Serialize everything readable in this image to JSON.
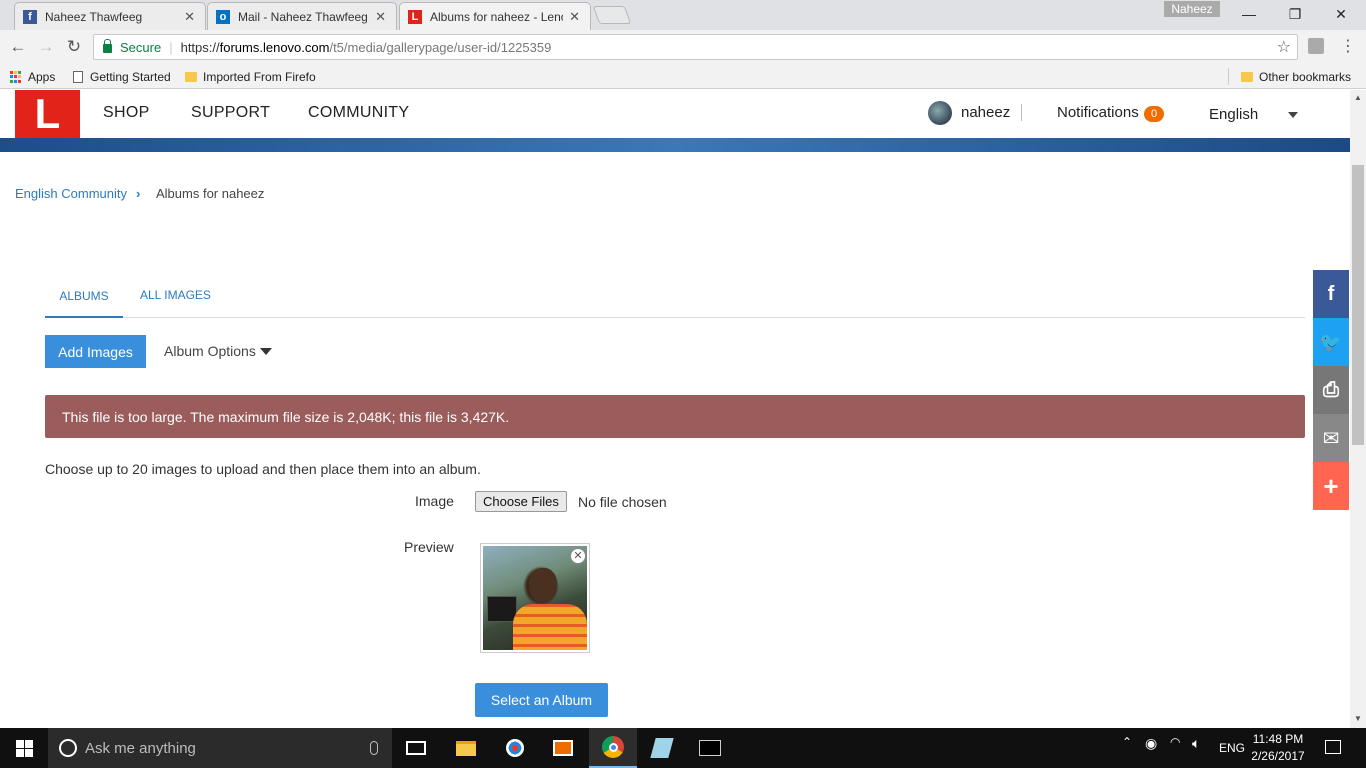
{
  "browser": {
    "tabs": [
      {
        "title": "Naheez Thawfeeg",
        "icon": "facebook-icon",
        "color": "#3b5998"
      },
      {
        "title": "Mail - Naheez Thawfeeg",
        "icon": "outlook-icon",
        "color": "#0072c6"
      },
      {
        "title": "Albums for naheez - Leno",
        "icon": "lenovo-icon",
        "color": "#e2231a"
      }
    ],
    "profile_name": "Naheez",
    "secure_label": "Secure",
    "url_scheme": "https://",
    "url_domain": "forums.lenovo.com",
    "url_path": "/t5/media/gallerypage/user-id/1225359",
    "bookmarks": {
      "apps": "Apps",
      "getting_started": "Getting Started",
      "imported": "Imported From Firefo",
      "other": "Other bookmarks"
    }
  },
  "site": {
    "logo_letter": "L",
    "nav": [
      "SHOP",
      "SUPPORT",
      "COMMUNITY"
    ],
    "username": "naheez",
    "notifications_label": "Notifications",
    "notifications_count": "0",
    "language": "English",
    "brand_color": "#e2231a"
  },
  "breadcrumb": {
    "root": "English Community",
    "current": "Albums for naheez"
  },
  "gallery": {
    "tabs": [
      "ALBUMS",
      "ALL IMAGES"
    ],
    "add_images": "Add Images",
    "album_options": "Album Options",
    "error": "This file is too large. The maximum file size is 2,048K; this file is 3,427K.",
    "instructions": "Choose up to 20 images to upload and then place them into an album.",
    "image_label": "Image",
    "choose_files": "Choose Files",
    "no_file": "No file chosen",
    "preview_label": "Preview",
    "select_album": "Select an Album"
  },
  "share": [
    {
      "icon": "facebook-icon",
      "color": "#3b5998",
      "glyph": "f"
    },
    {
      "icon": "twitter-icon",
      "color": "#1da1f2",
      "glyph": "🐦"
    },
    {
      "icon": "print-icon",
      "color": "#777777",
      "glyph": "⎙"
    },
    {
      "icon": "email-icon",
      "color": "#888888",
      "glyph": "✉"
    },
    {
      "icon": "more-icon",
      "color": "#ff6550",
      "glyph": "+"
    }
  ],
  "taskbar": {
    "search_placeholder": "Ask me anything",
    "language": "ENG",
    "time": "11:48 PM",
    "date": "2/26/2017"
  }
}
